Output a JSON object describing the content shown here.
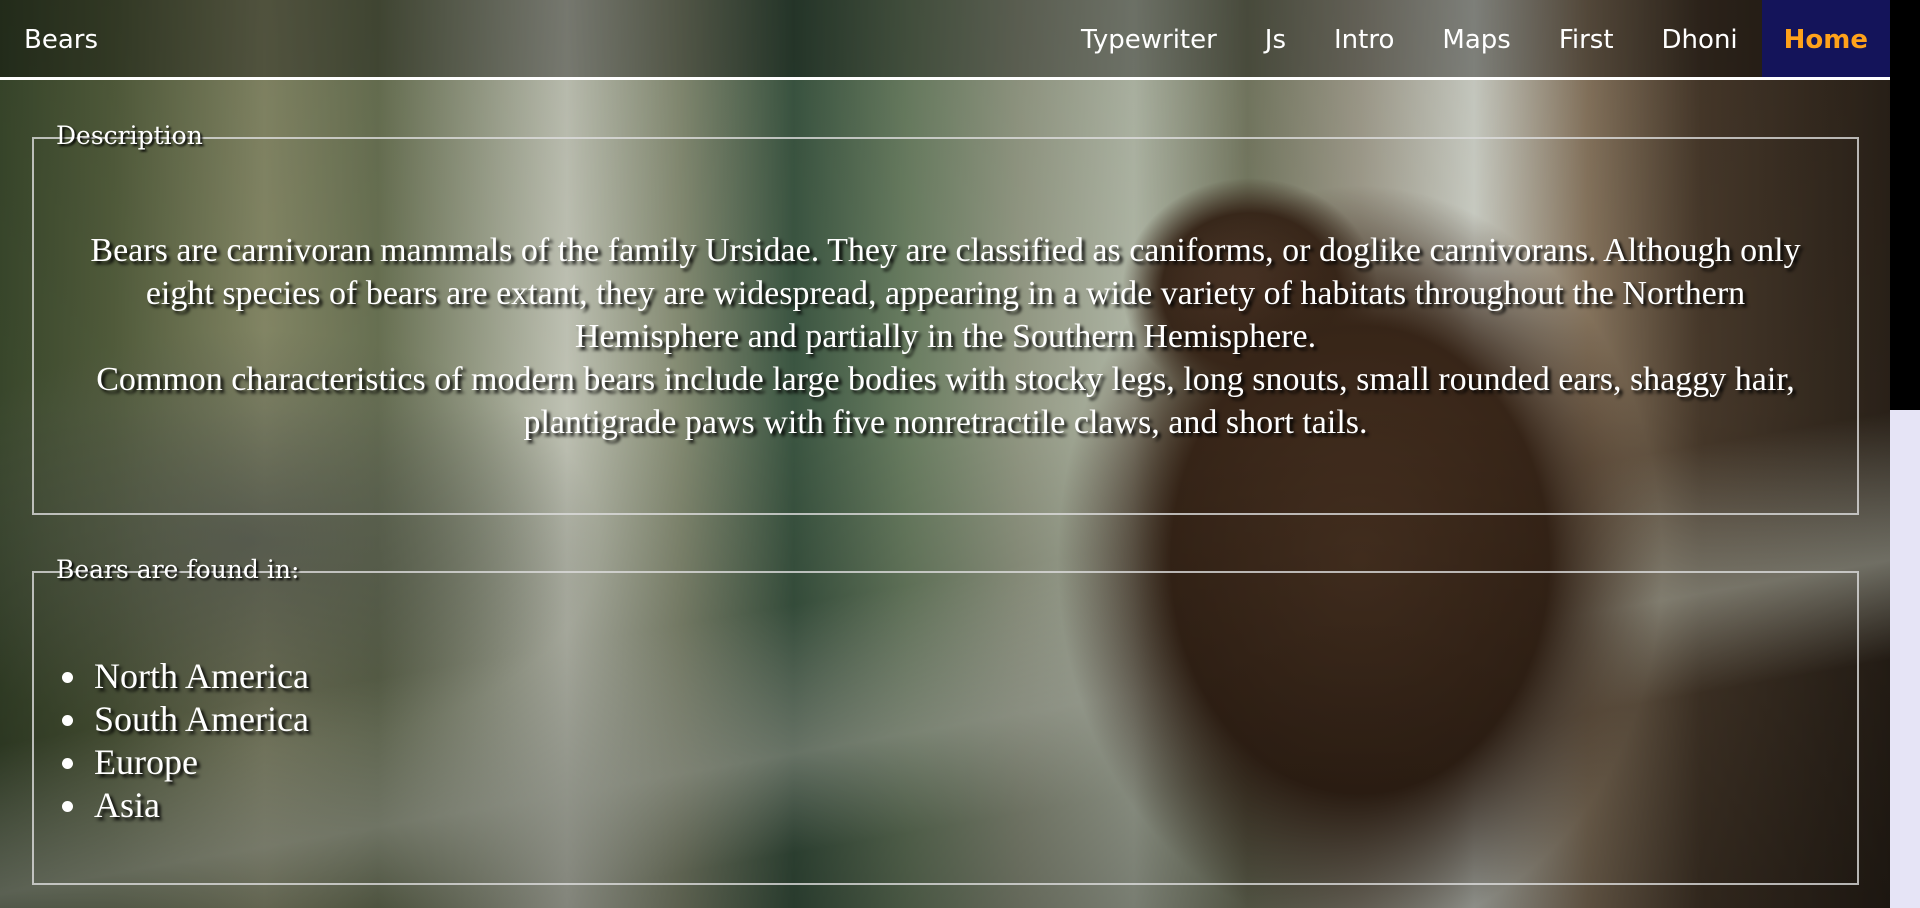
{
  "navbar": {
    "brand": "Bears",
    "links": [
      {
        "label": "Typewriter",
        "active": false
      },
      {
        "label": "Js",
        "active": false
      },
      {
        "label": "Intro",
        "active": false
      },
      {
        "label": "Maps",
        "active": false
      },
      {
        "label": "First",
        "active": false
      },
      {
        "label": "Dhoni",
        "active": false
      },
      {
        "label": "Home",
        "active": true
      }
    ]
  },
  "description": {
    "legend": "Description",
    "line1": "Bears are carnivoran mammals of the family Ursidae. They are classified as caniforms, or doglike carnivorans. Although only eight species of bears are extant, they are widespread, appearing in a wide variety of habitats throughout the Northern Hemisphere and partially in the Southern Hemisphere.",
    "line2": "Common characteristics of modern bears include large bodies with stocky legs, long snouts, small rounded ears, shaggy hair, plantigrade paws with five nonretractile claws, and short tails."
  },
  "found": {
    "legend": "Bears are found in:",
    "regions": [
      "North America",
      "South America",
      "Europe",
      "Asia"
    ]
  },
  "colors": {
    "active_nav_bg": "#14145a",
    "active_nav_text": "#ffa21a",
    "text": "#ffffff"
  }
}
